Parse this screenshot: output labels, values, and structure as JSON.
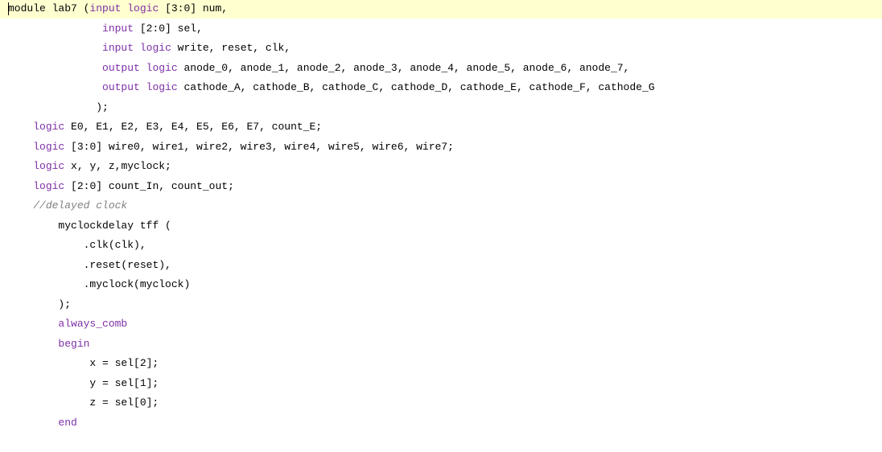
{
  "editor": {
    "lines": [
      {
        "indent": "",
        "tokens": [
          {
            "t": "module lab7 (",
            "k": "pl"
          },
          {
            "t": "input",
            "k": "kw"
          },
          {
            "t": " ",
            "k": "pl"
          },
          {
            "t": "logic",
            "k": "kw"
          },
          {
            "t": " [3:0] num,",
            "k": "pl"
          }
        ]
      },
      {
        "indent": "               ",
        "tokens": [
          {
            "t": "input",
            "k": "kw"
          },
          {
            "t": " [2:0] sel,",
            "k": "pl"
          }
        ]
      },
      {
        "indent": "               ",
        "tokens": [
          {
            "t": "input",
            "k": "kw"
          },
          {
            "t": " ",
            "k": "pl"
          },
          {
            "t": "logic",
            "k": "kw"
          },
          {
            "t": " write, reset, clk,",
            "k": "pl"
          }
        ]
      },
      {
        "indent": "               ",
        "tokens": [
          {
            "t": "output",
            "k": "kw"
          },
          {
            "t": " ",
            "k": "pl"
          },
          {
            "t": "logic",
            "k": "kw"
          },
          {
            "t": " anode_0, anode_1, anode_2, anode_3, anode_4, anode_5, anode_6, anode_7,",
            "k": "pl"
          }
        ]
      },
      {
        "indent": "               ",
        "tokens": [
          {
            "t": "output",
            "k": "kw"
          },
          {
            "t": " ",
            "k": "pl"
          },
          {
            "t": "logic",
            "k": "kw"
          },
          {
            "t": " cathode_A, cathode_B, cathode_C, cathode_D, cathode_E, cathode_F, cathode_G",
            "k": "pl"
          }
        ]
      },
      {
        "indent": "              ",
        "tokens": [
          {
            "t": ");",
            "k": "pl"
          }
        ]
      },
      {
        "indent": "    ",
        "tokens": [
          {
            "t": "logic",
            "k": "kw"
          },
          {
            "t": " E0, E1, E2, E3, E4, E5, E6, E7, count_E;",
            "k": "pl"
          }
        ]
      },
      {
        "indent": "    ",
        "tokens": [
          {
            "t": "logic",
            "k": "kw"
          },
          {
            "t": " [3:0] wire0, wire1, wire2, wire3, wire4, wire5, wire6, wire7;",
            "k": "pl"
          }
        ]
      },
      {
        "indent": "    ",
        "tokens": [
          {
            "t": "logic",
            "k": "kw"
          },
          {
            "t": " x, y, z,myclock;",
            "k": "pl"
          }
        ]
      },
      {
        "indent": "    ",
        "tokens": [
          {
            "t": "logic",
            "k": "kw"
          },
          {
            "t": " [2:0] count_In, count_out;",
            "k": "pl"
          }
        ]
      },
      {
        "indent": "    ",
        "tokens": [
          {
            "t": "//delayed clock",
            "k": "cm"
          }
        ]
      },
      {
        "indent": "        ",
        "tokens": [
          {
            "t": "myclockdelay tff (",
            "k": "pl"
          }
        ]
      },
      {
        "indent": "            ",
        "tokens": [
          {
            "t": ".clk(clk),",
            "k": "pl"
          }
        ]
      },
      {
        "indent": "            ",
        "tokens": [
          {
            "t": ".reset(reset),",
            "k": "pl"
          }
        ]
      },
      {
        "indent": "            ",
        "tokens": [
          {
            "t": ".myclock(myclock)",
            "k": "pl"
          }
        ]
      },
      {
        "indent": "        ",
        "tokens": [
          {
            "t": ");",
            "k": "pl"
          }
        ]
      },
      {
        "indent": "        ",
        "tokens": [
          {
            "t": "always_comb",
            "k": "kw"
          }
        ]
      },
      {
        "indent": "        ",
        "tokens": [
          {
            "t": "begin",
            "k": "kw"
          }
        ]
      },
      {
        "indent": "             ",
        "tokens": [
          {
            "t": "x = sel[2];",
            "k": "pl"
          }
        ]
      },
      {
        "indent": "             ",
        "tokens": [
          {
            "t": "y = sel[1];",
            "k": "pl"
          }
        ]
      },
      {
        "indent": "             ",
        "tokens": [
          {
            "t": "z = sel[0];",
            "k": "pl"
          }
        ]
      },
      {
        "indent": "        ",
        "tokens": [
          {
            "t": "end",
            "k": "kw"
          }
        ]
      }
    ],
    "colors": {
      "keyword": "#7d2fa6",
      "comment": "#808080",
      "text": "#000000",
      "current_line": "#ffffd0"
    }
  }
}
